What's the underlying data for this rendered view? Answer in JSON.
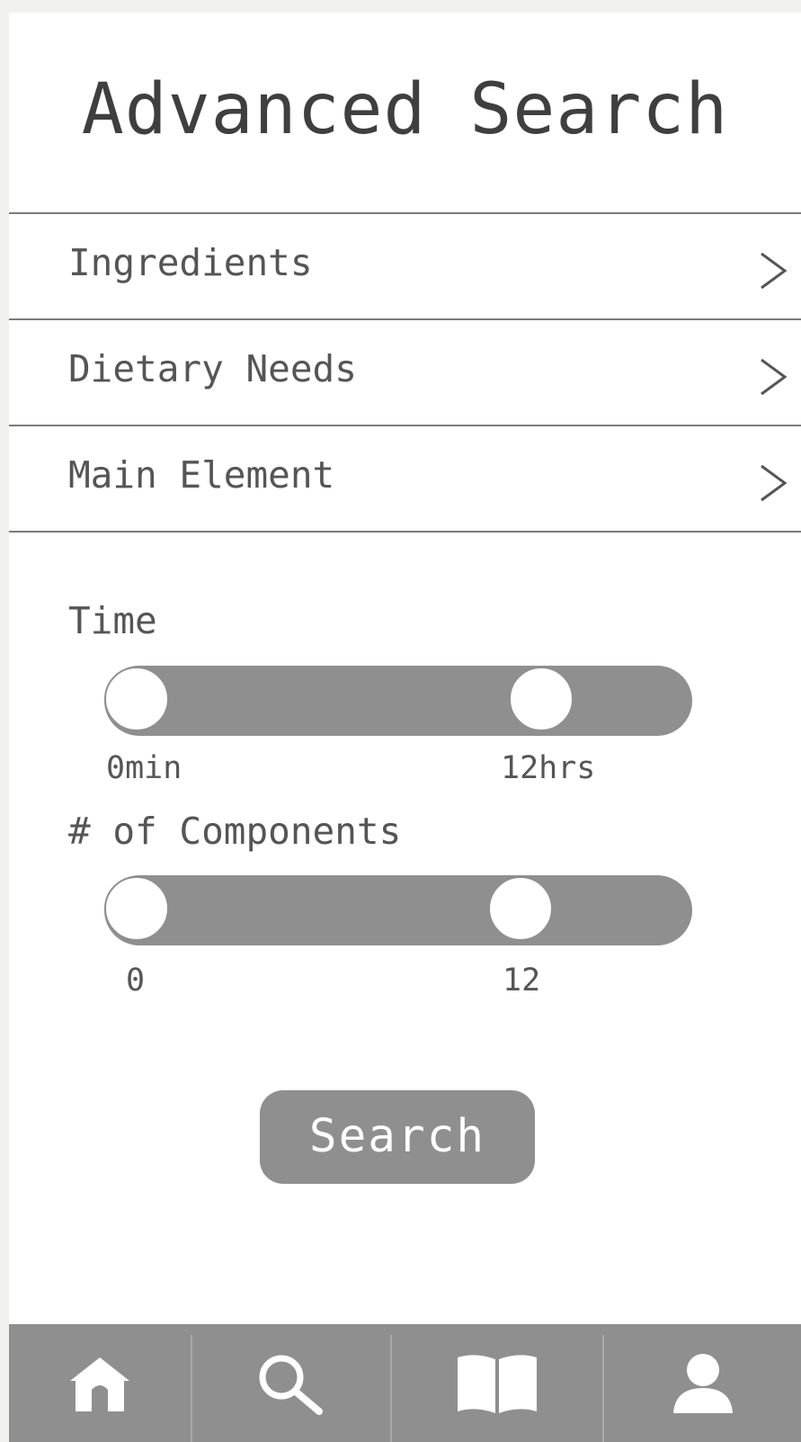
{
  "header": {
    "title": "Advanced Search"
  },
  "filters": [
    {
      "label": "Ingredients",
      "icon": "chevron-right-icon"
    },
    {
      "label": "Dietary Needs",
      "icon": "chevron-right-icon"
    },
    {
      "label": "Main Element",
      "icon": "chevron-right-icon"
    }
  ],
  "sliders": {
    "time": {
      "label": "Time",
      "min_label": "0min",
      "max_label": "12hrs"
    },
    "components": {
      "label": "# of Components",
      "min_label": "0",
      "max_label": "12"
    }
  },
  "search_button": {
    "label": "Search"
  },
  "tabbar": {
    "items": [
      {
        "icon": "home-icon"
      },
      {
        "icon": "search-icon"
      },
      {
        "icon": "book-icon"
      },
      {
        "icon": "user-icon"
      }
    ]
  },
  "colors": {
    "control_gray": "#8f8f8f",
    "background": "#ffffff",
    "text": "#4a4a4a"
  }
}
